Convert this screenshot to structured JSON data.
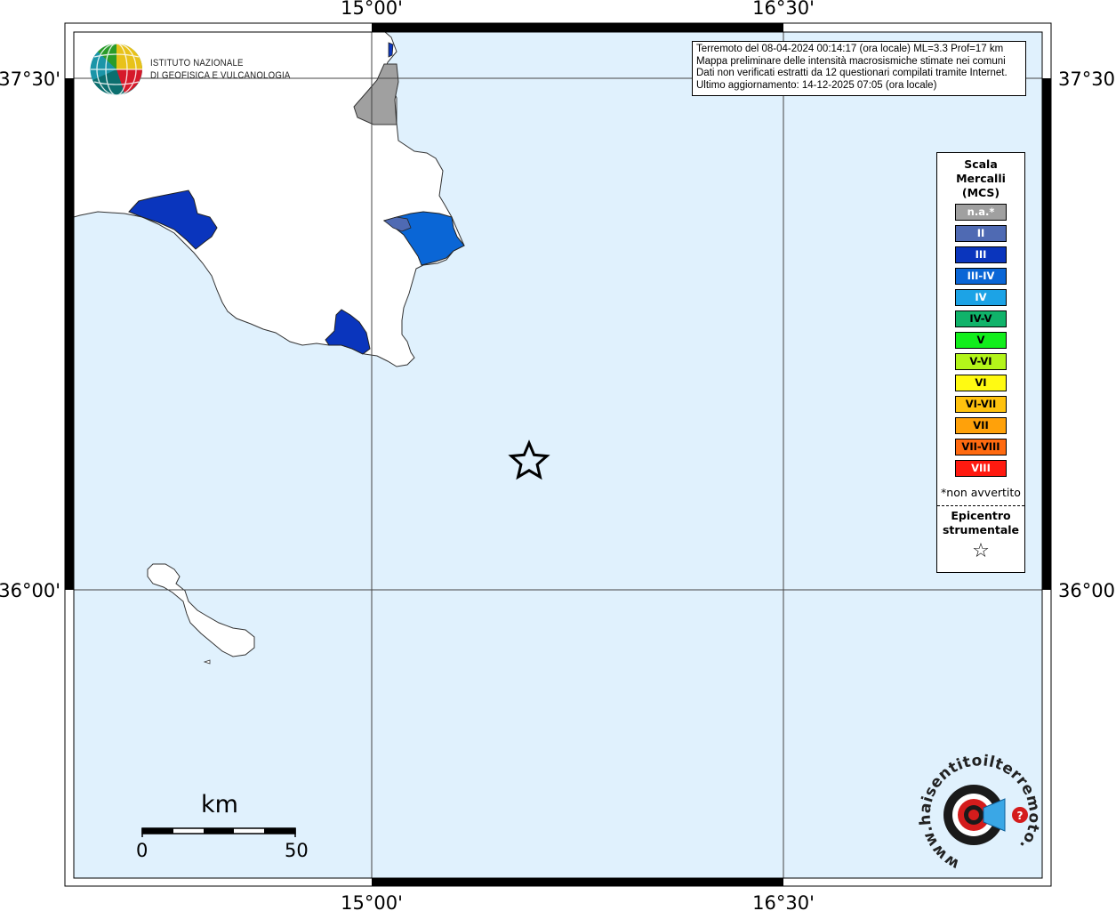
{
  "info": {
    "line1": "Terremoto del 08-04-2024 00:14:17 (ora locale) ML=3.3 Prof=17 km",
    "line2": "Mappa preliminare delle intensità macrosismiche stimate nei comuni",
    "line3": "Dati non verificati estratti da 12 questionari compilati tramite Internet.",
    "line4": "Ultimo aggiornamento: 14-12-2025 07:05 (ora locale)"
  },
  "logo": {
    "line1": "ISTITUTO NAZIONALE",
    "line2": "DI GEOFISICA E VULCANOLOGIA"
  },
  "axes": {
    "top_lon": [
      "15°00'",
      "16°30'"
    ],
    "bottom_lon": [
      "15°00'",
      "16°30'"
    ],
    "left_lat": [
      "37°30'",
      "36°00'"
    ],
    "right_lat": [
      "37°30'",
      "36°00'"
    ]
  },
  "legend": {
    "title1": "Scala",
    "title2": "Mercalli",
    "title3": "(MCS)",
    "items": [
      {
        "label": "n.a.*",
        "color": "#a0a0a0",
        "text_color": "#ffffff"
      },
      {
        "label": "II",
        "color": "#4f6ab3",
        "text_color": "#ffffff"
      },
      {
        "label": "III",
        "color": "#0a35bd",
        "text_color": "#ffffff"
      },
      {
        "label": "III-IV",
        "color": "#0a66d6",
        "text_color": "#ffffff"
      },
      {
        "label": "IV",
        "color": "#1ca3e6",
        "text_color": "#ffffff"
      },
      {
        "label": "IV-V",
        "color": "#10b36a",
        "text_color": "#000000"
      },
      {
        "label": "V",
        "color": "#12ee1c",
        "text_color": "#000000"
      },
      {
        "label": "V-VI",
        "color": "#b3f51a",
        "text_color": "#000000"
      },
      {
        "label": "VI",
        "color": "#fffa12",
        "text_color": "#000000"
      },
      {
        "label": "VI-VII",
        "color": "#ffc20e",
        "text_color": "#000000"
      },
      {
        "label": "VII",
        "color": "#ffa10a",
        "text_color": "#000000"
      },
      {
        "label": "VII-VIII",
        "color": "#ff6a10",
        "text_color": "#000000"
      },
      {
        "label": "VIII",
        "color": "#ff1a10",
        "text_color": "#ffffff"
      }
    ],
    "note": "*non avvertito",
    "epi1": "Epicentro",
    "epi2": "strumentale",
    "epi_symbol": "☆"
  },
  "scalebar": {
    "unit": "km",
    "min": "0",
    "max": "50"
  },
  "watermark": {
    "text": "www.haisentitoilterremoto.it"
  },
  "colors": {
    "sea": "#e0f1fd",
    "land": "#ffffff",
    "intensity_na": "#a0a0a0",
    "intensity_III": "#0a35bd",
    "intensity_III_IV": "#0a66d6",
    "intensity_II": "#4f6ab3"
  }
}
